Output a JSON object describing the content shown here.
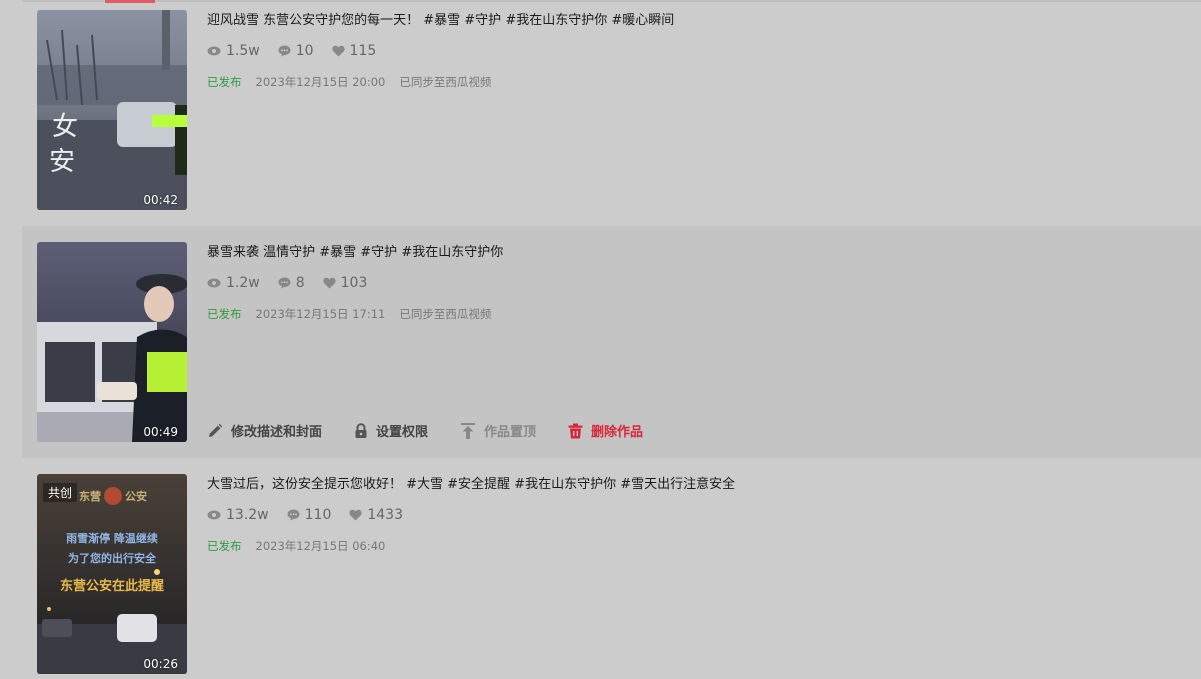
{
  "colors": {
    "background": "#cccccc",
    "published": "#2e9c3c",
    "danger": "#d8263b",
    "accent": "#e05a68"
  },
  "videos": [
    {
      "title": "迎风战雪 东营公安守护您的每一天！ #暴雪 #守护 #我在山东守护你 #暖心瞬间",
      "views": "1.5w",
      "comments": "10",
      "likes": "115",
      "status": "已发布",
      "date": "2023年12月15日 20:00",
      "sync": "已同步至西瓜视频",
      "duration": "00:42"
    },
    {
      "title": "暴雪来袭 温情守护 #暴雪 #守护 #我在山东守护你",
      "views": "1.2w",
      "comments": "8",
      "likes": "103",
      "status": "已发布",
      "date": "2023年12月15日 17:11",
      "sync": "已同步至西瓜视频",
      "duration": "00:49",
      "actions": {
        "edit": "修改描述和封面",
        "permission": "设置权限",
        "pin": "作品置顶",
        "delete": "删除作品"
      }
    },
    {
      "title": "大雪过后，这份安全提示您收好！ #大雪 #安全提醒 #我在山东守护你 #雪天出行注意安全",
      "views": "13.2w",
      "comments": "110",
      "likes": "1433",
      "status": "已发布",
      "date": "2023年12月15日 06:40",
      "duration": "00:26",
      "badge": "共创",
      "thumb_text": {
        "logo_left": "东营",
        "logo_right": "公安",
        "line1": "雨雪渐停 降温继续",
        "line2": "为了您的出行安全",
        "line3": "东营公安在此提醒"
      }
    }
  ],
  "icons": {
    "views": "eye-icon",
    "comments": "comment-icon",
    "likes": "heart-icon",
    "edit": "pencil-icon",
    "permission": "lock-icon",
    "pin": "pin-top-icon",
    "delete": "trash-icon"
  }
}
